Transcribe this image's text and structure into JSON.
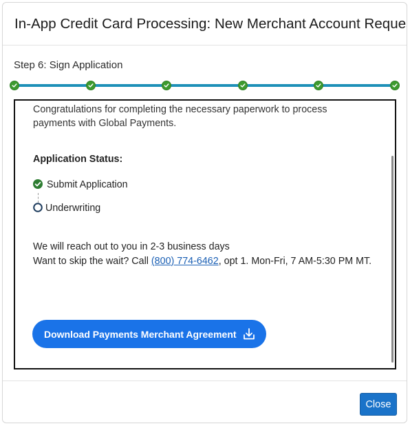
{
  "dialog": {
    "title": "In-App Credit Card Processing: New Merchant Account Request"
  },
  "progress": {
    "step_label": "Step 6: Sign Application",
    "total_steps": 6,
    "completed_steps": 6,
    "accent_color": "#1e90b8",
    "completed_color": "#3d9a2f"
  },
  "content": {
    "intro": "Congratulations for completing the necessary paperwork to process payments with Global Payments.",
    "status_heading": "Application Status:",
    "status_items": [
      {
        "label": "Submit Application",
        "state": "complete",
        "icon": "check-circle-icon"
      },
      {
        "label": "Underwriting",
        "state": "pending",
        "icon": "empty-circle-icon"
      }
    ],
    "reach_line": "We will reach out to you in 2-3 business days",
    "skip_prefix": "Want to skip the wait? Call ",
    "phone": "(800) 774-6462",
    "skip_suffix": ", opt 1. Mon-Fri, 7 AM-5:30 PM MT.",
    "download_label": "Download Payments Merchant Agreement",
    "download_icon": "download-icon"
  },
  "footer": {
    "close_label": "Close"
  }
}
